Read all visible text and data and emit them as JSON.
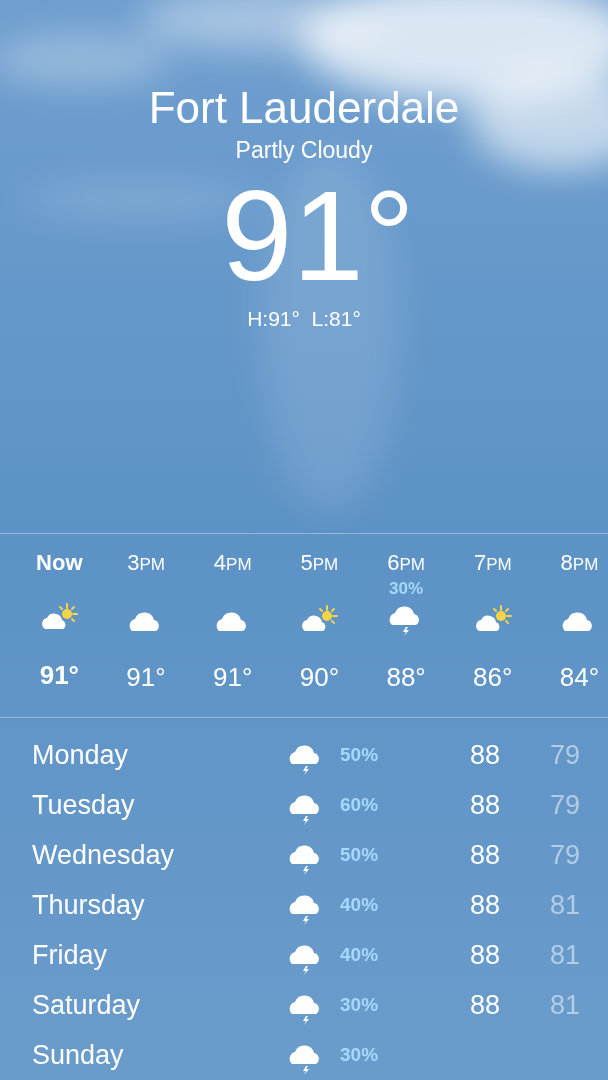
{
  "location": {
    "city": "Fort Lauderdale",
    "condition": "Partly Cloudy",
    "temperature": "91°",
    "high_low": "H:91°  L:81°"
  },
  "hourly": [
    {
      "time": "Now",
      "current": true,
      "kind": "partly-sunny",
      "temp": "91°"
    },
    {
      "time": "3PM",
      "current": false,
      "kind": "cloudy",
      "temp": "91°"
    },
    {
      "time": "4PM",
      "current": false,
      "kind": "cloudy",
      "temp": "91°"
    },
    {
      "time": "5PM",
      "current": false,
      "kind": "partly-sunny",
      "temp": "90°"
    },
    {
      "time": "6PM",
      "current": false,
      "kind": "thunder",
      "precip": "30%",
      "temp": "88°"
    },
    {
      "time": "7PM",
      "current": false,
      "kind": "partly-sunny",
      "temp": "86°"
    },
    {
      "time": "8PM",
      "current": false,
      "kind": "cloudy",
      "temp": "84°"
    }
  ],
  "daily": [
    {
      "day": "Monday",
      "kind": "thunder",
      "precip": "50%",
      "high": "88",
      "low": "79"
    },
    {
      "day": "Tuesday",
      "kind": "thunder",
      "precip": "60%",
      "high": "88",
      "low": "79"
    },
    {
      "day": "Wednesday",
      "kind": "thunder",
      "precip": "50%",
      "high": "88",
      "low": "79"
    },
    {
      "day": "Thursday",
      "kind": "thunder",
      "precip": "40%",
      "high": "88",
      "low": "81"
    },
    {
      "day": "Friday",
      "kind": "thunder",
      "precip": "40%",
      "high": "88",
      "low": "81"
    },
    {
      "day": "Saturday",
      "kind": "thunder",
      "precip": "30%",
      "high": "88",
      "low": "81"
    },
    {
      "day": "Sunday",
      "kind": "thunder",
      "precip": "30%"
    }
  ]
}
